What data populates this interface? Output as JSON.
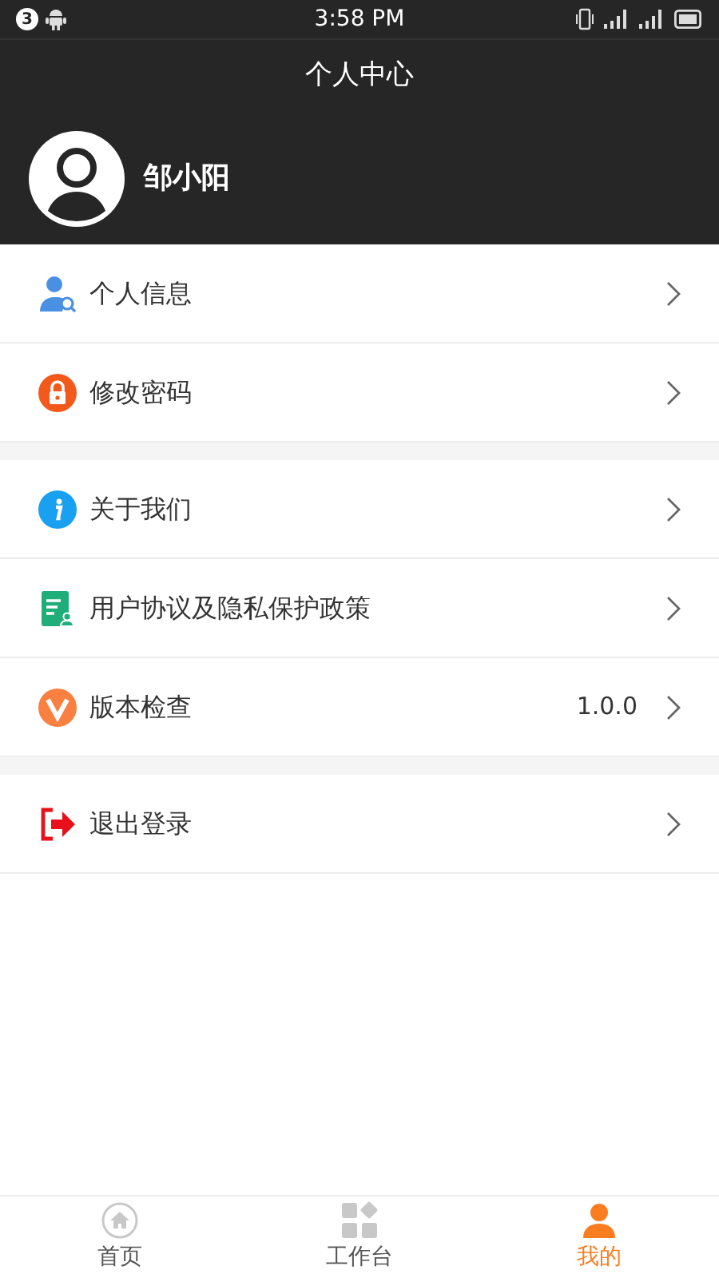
{
  "status_bar": {
    "notification_count": "3",
    "time": "3:58 PM"
  },
  "header": {
    "title": "个人中心"
  },
  "profile": {
    "name": "邹小阳"
  },
  "menu_groups": [
    {
      "items": [
        {
          "kind": "person",
          "label": "个人信息"
        },
        {
          "kind": "lock",
          "label": "修改密码"
        }
      ]
    },
    {
      "items": [
        {
          "kind": "info",
          "label": "关于我们"
        },
        {
          "kind": "document",
          "label": "用户协议及隐私保护政策"
        },
        {
          "kind": "version",
          "label": "版本检查",
          "value": "1.0.0"
        }
      ]
    },
    {
      "items": [
        {
          "kind": "logout",
          "label": "退出登录"
        }
      ]
    }
  ],
  "tab_bar": [
    {
      "kind": "home",
      "label": "首页",
      "selected": false
    },
    {
      "kind": "grid",
      "label": "工作台",
      "selected": false
    },
    {
      "kind": "person",
      "label": "我的",
      "selected": true
    }
  ]
}
